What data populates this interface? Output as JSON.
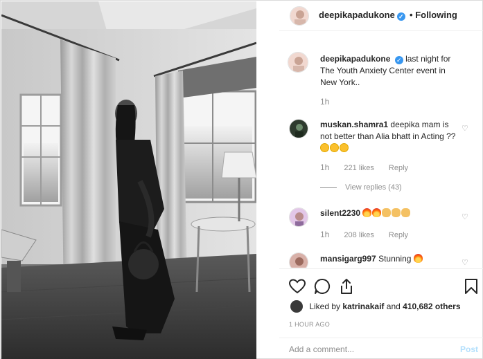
{
  "post": {
    "username": "deepikapadukone",
    "follow_label": "Following",
    "separator": "•",
    "caption": "last night for The Youth Anxiety Center event in New York..",
    "caption_time": "1h"
  },
  "comments": [
    {
      "username": "muskan.shamra1",
      "text": "deepika mam is not better than Alia bhatt in Acting ??",
      "time": "1h",
      "likes": "221 likes",
      "reply": "Reply",
      "view_replies": "View replies (43)"
    },
    {
      "username": "silent2230",
      "text": "",
      "time": "1h",
      "likes": "208 likes",
      "reply": "Reply"
    },
    {
      "username": "mansigarg997",
      "text": "Stunning"
    }
  ],
  "actions": {
    "liked_prefix": "Liked by",
    "liked_user": "katrinakaif",
    "liked_and": "and",
    "liked_count": "410,682 others",
    "post_time": "1 HOUR AGO"
  },
  "comment_box": {
    "placeholder": "Add a comment...",
    "post_label": "Post"
  },
  "icons": [
    "heart-icon",
    "comment-icon",
    "share-icon",
    "bookmark-icon",
    "verified-icon"
  ],
  "colors": {
    "link_blue": "#3897f0",
    "muted": "#8e8e8e",
    "post_disabled": "#b2dffc"
  }
}
